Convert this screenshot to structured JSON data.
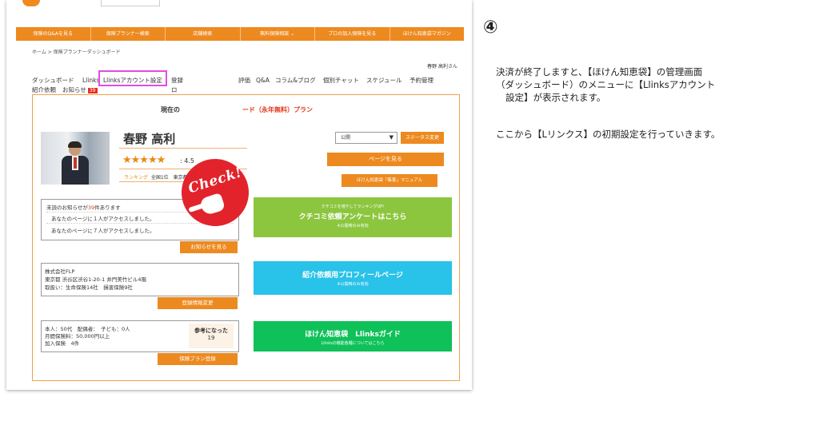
{
  "top_nav": [
    "保険のQ&Aを見る",
    "保険プランナー検索",
    "店舗検索",
    "無料保険相談 ⌄",
    "プロの加入保険を見る",
    "ほけん知恵袋マガジン"
  ],
  "breadcrumb": "ホーム > 保険プランナーダッシュボード",
  "username": "春野 高利さん",
  "menu": {
    "dashboard": "ダッシュボード",
    "llinks": "Llinks",
    "llinks_settings": "Llinksアカウント設定",
    "register": "登録",
    "review": "評価",
    "qa": "Q&A",
    "column": "コラム&ブログ",
    "chat": "個別チャット",
    "schedule": "スケジュール",
    "reservation": "予約管理",
    "referral": "紹介依頼",
    "notice": "お知らせ",
    "notice_badge": "39",
    "tail": "ロ"
  },
  "plan": {
    "prefix": "現在の",
    "suffix": "ード（永年無料）プラン"
  },
  "check_badge": "Check!",
  "profile": {
    "name": "春野 高利",
    "stars": "★★★★★",
    "rating": ": 4.5",
    "ranking_label": "ランキング",
    "ranking_value": "全国1位　東京都1位"
  },
  "status": {
    "select_value": "公開",
    "select_arrow": "▼",
    "change_button": "ステータス変更"
  },
  "page_button": "ページを見る",
  "manual_button": "ほけん知恵袋「集客」マニュアル",
  "notice": {
    "prefix": "未読のお知らせが",
    "count": "39",
    "suffix": "件あります",
    "items": [
      "あなたのページに１人がアクセスしました。",
      "あなたのページに７人がアクセスしました。"
    ],
    "button": "お知らせを見る"
  },
  "company": {
    "name": "株式会社FLP",
    "address": "東京都 渋谷区渋谷1-20-1 井門美竹ビル4階",
    "handling": "取扱い：生命保険14社　損害保険9社",
    "button": "登録情報変更"
  },
  "family": {
    "line1": "本人：50代　配偶者：　子ども：0人",
    "line2": "月間保険料：50,000円以上",
    "line3": "加入保険　4件",
    "helpful_label": "参考になった",
    "helpful_count": "19",
    "button": "保険プラン登録"
  },
  "promos": {
    "green_small": "クチコミを増やしてランキングUP!",
    "green_big": "クチコミ依頼アンケートはこちら",
    "green_note": "※公開時のみ有効",
    "blue_big": "紹介依頼用プロフィールページ",
    "blue_note": "※公開時のみ有効",
    "dark_big": "ほけん知恵袋　Llinksガイド",
    "dark_note": "Llinksの機能各種についてはこちら"
  },
  "right": {
    "step": "④",
    "desc_lines": [
      "決済が終了しますと、【ほけん知恵袋】の管理画面",
      "（ダッシュボード）のメニューに【Llinksアカウント",
      "設定】が表示されます。"
    ],
    "desc2": "ここから【Lリンクス】の初期設定を行っていきます。"
  },
  "colors": {
    "orange": "#ed8a1f",
    "highlight": "#e24ce4",
    "check": "#e2232c",
    "green": "#8cc63f",
    "blue": "#29c2e8",
    "dark_green": "#0fc159"
  }
}
